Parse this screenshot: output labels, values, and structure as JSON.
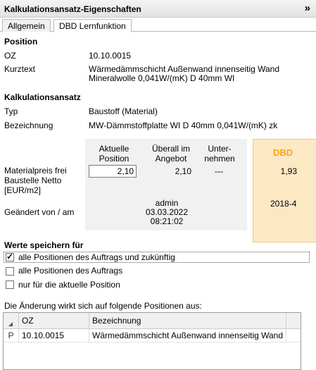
{
  "panel": {
    "title": "Kalkulationsansatz-Eigenschaften",
    "collapse_glyph": "»"
  },
  "tabs": [
    {
      "label": "Allgemein"
    },
    {
      "label": "DBD Lernfunktion"
    }
  ],
  "position": {
    "heading": "Position",
    "oz_label": "OZ",
    "oz_value": "10.10.0015",
    "kurztext_label": "Kurztext",
    "kurztext_line1": "Wärmedämmschicht Außenwand innenseitig Wand",
    "kurztext_line2": "Mineralwolle 0,041W/(mK) D 40mm WI"
  },
  "ansatz": {
    "heading": "Kalkulationsansatz",
    "typ_label": "Typ",
    "typ_value": "Baustoff (Material)",
    "bez_label": "Bezeichnung",
    "bez_value": "MW-Dämmstoffplatte WI D 40mm 0,041W/(mK) zk"
  },
  "grid": {
    "col_aktuelle_1": "Aktuelle",
    "col_aktuelle_2": "Position",
    "col_angebot_1": "Überall im",
    "col_angebot_2": "Angebot",
    "col_unternehmen_1": "Unter-",
    "col_unternehmen_2": "nehmen",
    "col_dbd": "DBD",
    "row1_label_1": "Materialpreis frei",
    "row1_label_2": "Baustelle Netto",
    "row1_label_3": "[EUR/m2]",
    "row1_aktuelle": "2,10",
    "row1_angebot": "2,10",
    "row1_unternehmen": "---",
    "row1_dbd": "1,93",
    "row2_label": "Geändert von / am",
    "row2_angebot_1": "admin",
    "row2_angebot_2": "03.03.2022",
    "row2_angebot_3": "08:21:02",
    "row2_dbd": "2018-4"
  },
  "save": {
    "heading": "Werte speichern für",
    "options": [
      {
        "label": "alle Positionen des Auftrags und zukünftig",
        "checked": true
      },
      {
        "label": "alle Positionen des Auftrags",
        "checked": false
      },
      {
        "label": "nur für die aktuelle Position",
        "checked": false
      }
    ]
  },
  "affected": {
    "caption": "Die Änderung wirkt sich auf folgende Positionen aus:",
    "columns": [
      "",
      "OZ",
      "Bezeichnung"
    ],
    "rows": [
      {
        "flag": "P",
        "oz": "10.10.0015",
        "bez": "Wärmedämmschicht Außenwand innenseitig Wand"
      }
    ]
  },
  "colors": {
    "dbd_accent": "#f5a623",
    "dbd_background": "#fde8c4"
  }
}
